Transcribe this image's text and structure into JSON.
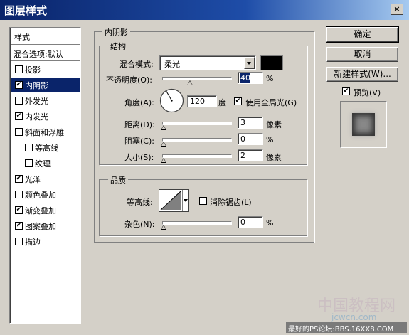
{
  "window": {
    "title": "图层样式",
    "close": "×"
  },
  "sidebar": {
    "header": "样式",
    "blend_options": "混合选项:默认",
    "items": [
      {
        "label": "投影",
        "checked": false
      },
      {
        "label": "内阴影",
        "checked": true
      },
      {
        "label": "外发光",
        "checked": false
      },
      {
        "label": "内发光",
        "checked": true
      },
      {
        "label": "斜面和浮雕",
        "checked": false
      },
      {
        "label": "等高线",
        "checked": false
      },
      {
        "label": "纹理",
        "checked": false
      },
      {
        "label": "光泽",
        "checked": true
      },
      {
        "label": "颜色叠加",
        "checked": false
      },
      {
        "label": "渐变叠加",
        "checked": true
      },
      {
        "label": "图案叠加",
        "checked": true
      },
      {
        "label": "描边",
        "checked": false
      }
    ]
  },
  "inner_shadow": {
    "title": "内阴影",
    "structure": {
      "title": "结构",
      "blend_mode_label": "混合模式:",
      "blend_mode_value": "柔光",
      "blend_color": "#000000",
      "opacity_label": "不透明度(O):",
      "opacity_value": "40",
      "opacity_unit": "%",
      "angle_label": "角度(A):",
      "angle_value": "120",
      "angle_unit": "度",
      "global_light_label": "使用全局光(G)",
      "global_light_checked": true,
      "distance_label": "距离(D):",
      "distance_value": "3",
      "distance_unit": "像素",
      "choke_label": "阻塞(C):",
      "choke_value": "0",
      "choke_unit": "%",
      "size_label": "大小(S):",
      "size_value": "2",
      "size_unit": "像素"
    },
    "quality": {
      "title": "品质",
      "contour_label": "等高线:",
      "antialias_label": "消除锯齿(L)",
      "antialias_checked": false,
      "noise_label": "杂色(N):",
      "noise_value": "0",
      "noise_unit": "%"
    }
  },
  "buttons": {
    "ok": "确定",
    "cancel": "取消",
    "new_style": "新建样式(W)...",
    "preview_label": "预览(V)",
    "preview_checked": true
  },
  "watermark": {
    "cn": "中国教程网",
    "url": "jcwcn.com",
    "footer": "最好的PS论坛:BBS.16XX8.COM"
  }
}
